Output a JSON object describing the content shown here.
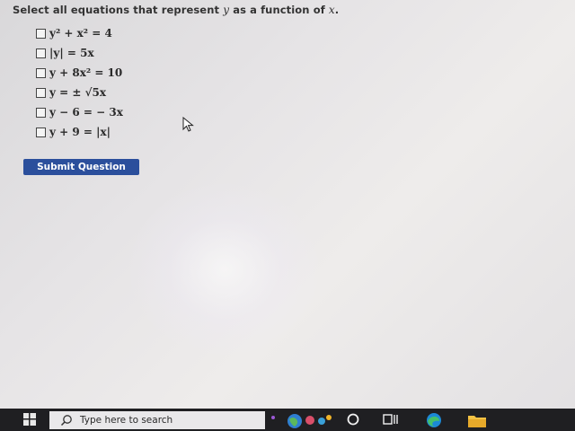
{
  "question": {
    "prompt_before": "Select all equations that represent",
    "var_y": "y",
    "prompt_middle": "as a function of",
    "var_x": "x",
    "prompt_end": "."
  },
  "options": [
    {
      "label": "y² + x² = 4",
      "checked": false
    },
    {
      "label": "|y| = 5x",
      "checked": false
    },
    {
      "label": "y + 8x² = 10",
      "checked": false
    },
    {
      "label": "y = ± √5x",
      "checked": false
    },
    {
      "label": "y − 6 = − 3x",
      "checked": false
    },
    {
      "label": "y + 9 = |x|",
      "checked": false
    }
  ],
  "submit_label": "Submit Question",
  "taskbar": {
    "search_placeholder": "Type here to search",
    "icons": [
      "windows-start-icon",
      "search-icon",
      "weather-widget-icon",
      "cortana-icon",
      "task-view-icon",
      "edge-icon",
      "file-explorer-icon"
    ]
  },
  "colors": {
    "submit_bg": "#2b4f9c",
    "taskbar_bg": "#1f1f22"
  }
}
